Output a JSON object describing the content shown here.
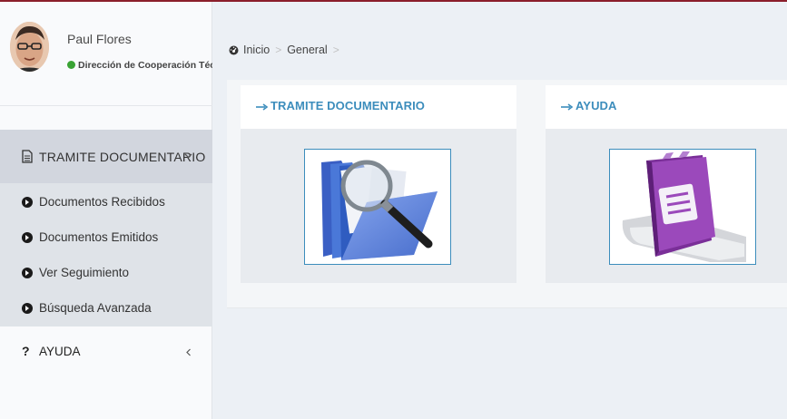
{
  "user": {
    "name": "Paul Flores",
    "department": "Dirección de Cooperación Técn",
    "status_color": "#3aa335"
  },
  "sidebar": {
    "header": {
      "label": "TRAMITE DOCUMENTARIO",
      "icon": "document-icon",
      "chevron": "chevron-down-icon"
    },
    "items": [
      {
        "label": "Documentos Recibidos",
        "icon": "arrow-circle-right-icon"
      },
      {
        "label": "Documentos Emitidos",
        "icon": "arrow-circle-right-icon"
      },
      {
        "label": "Ver Seguimiento",
        "icon": "arrow-circle-right-icon"
      },
      {
        "label": "Búsqueda Avanzada",
        "icon": "arrow-circle-right-icon"
      }
    ],
    "ayuda": {
      "icon_text": "?",
      "label": "AYUDA",
      "chevron": "chevron-left-icon"
    }
  },
  "breadcrumb": {
    "icon": "dashboard-icon",
    "items": [
      "Inicio",
      "General"
    ]
  },
  "panels": [
    {
      "title": "TRAMITE DOCUMENTARIO",
      "image": "folder-magnifier-icon"
    },
    {
      "title": "AYUDA",
      "image": "help-book-icon"
    }
  ],
  "colors": {
    "accent": "#3c8dbc",
    "topline": "#8b1e2b",
    "menu_active": "#d2d6de"
  }
}
